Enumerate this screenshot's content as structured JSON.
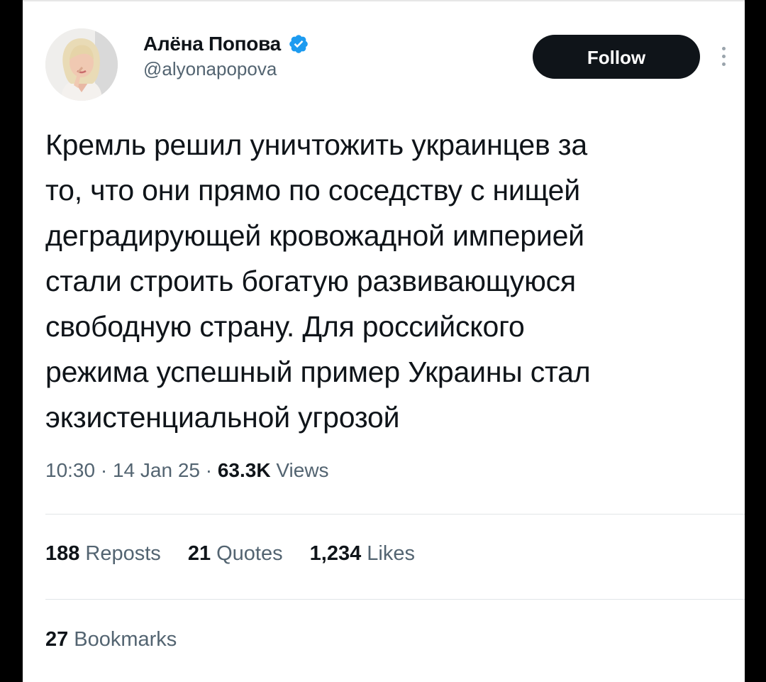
{
  "author": {
    "display_name": "Алёна Попова",
    "handle": "@alyonapopova",
    "verified": true,
    "avatar": "profile-photo"
  },
  "follow_button": {
    "label": "Follow"
  },
  "more_menu": {
    "icon": "more-vertical-icon"
  },
  "tweet": {
    "lines": [
      "Кремль решил уничтожить украинцев за",
      "то, что они прямо по соседству с нищей",
      "деградирующей кровожадной империей",
      "стали строить богатую развивающуюся",
      "свободную страну. Для российского",
      "режима успешный пример Украины стал",
      "экзистенциальной угрозой"
    ]
  },
  "meta": {
    "time": "10:30",
    "separator": "·",
    "date": "14 Jan 25",
    "views_count": "63.3K",
    "views_label": "Views"
  },
  "stats": {
    "reposts": {
      "count": "188",
      "label": "Reposts"
    },
    "quotes": {
      "count": "21",
      "label": "Quotes"
    },
    "likes": {
      "count": "1,234",
      "label": "Likes"
    },
    "bookmarks": {
      "count": "27",
      "label": "Bookmarks"
    }
  },
  "colors": {
    "background": "#ffffff",
    "text_primary": "#0f1419",
    "text_secondary": "#536471",
    "verified_badge": "#1d9bf0",
    "follow_button_bg": "#0f1419"
  }
}
